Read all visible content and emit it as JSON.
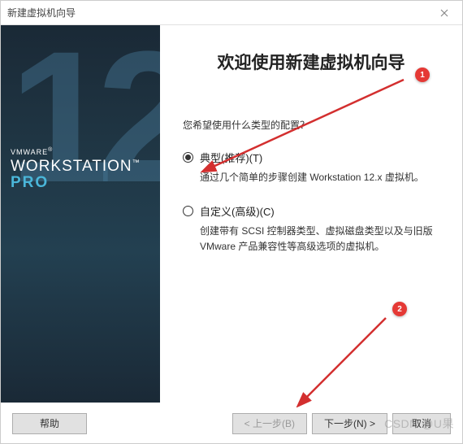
{
  "window": {
    "title": "新建虚拟机向导"
  },
  "sidebar": {
    "vmware": "VMWARE",
    "workstation": "WORKSTATION",
    "pro": "PRO",
    "version_glyph": "12"
  },
  "main": {
    "heading": "欢迎使用新建虚拟机向导",
    "prompt": "您希望使用什么类型的配置？",
    "options": [
      {
        "label": "典型(推荐)(T)",
        "desc": "通过几个简单的步骤创建 Workstation 12.x 虚拟机。",
        "checked": true
      },
      {
        "label": "自定义(高级)(C)",
        "desc": "创建带有 SCSI 控制器类型、虚拟磁盘类型以及与旧版 VMware 产品兼容性等高级选项的虚拟机。",
        "checked": false
      }
    ]
  },
  "annotations": {
    "badge1": "1",
    "badge2": "2"
  },
  "footer": {
    "help": "帮助",
    "back": "< 上一步(B)",
    "next": "下一步(N) >",
    "cancel": "取消"
  },
  "watermark": "CSDN @U果"
}
